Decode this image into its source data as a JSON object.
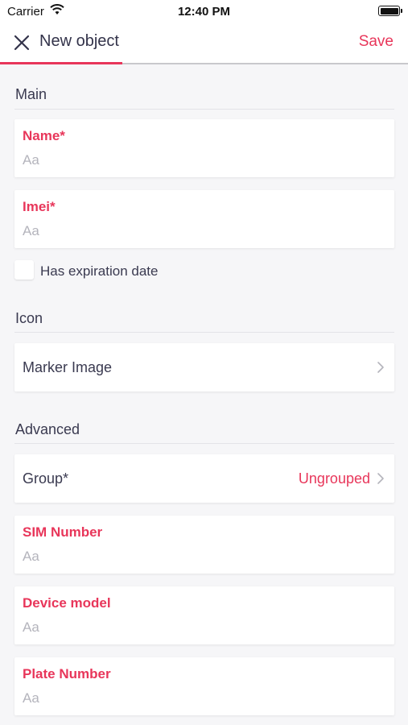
{
  "status_bar": {
    "carrier": "Carrier",
    "time": "12:40 PM"
  },
  "header": {
    "title": "New object",
    "save_label": "Save",
    "close_icon": "close-icon"
  },
  "sections": {
    "main": "Main",
    "icon": "Icon",
    "advanced": "Advanced"
  },
  "fields": {
    "name": {
      "label": "Name*",
      "placeholder": "Aa"
    },
    "imei": {
      "label": "Imei*",
      "placeholder": "Aa"
    },
    "sim_number": {
      "label": "SIM Number",
      "placeholder": "Aa"
    },
    "device_model": {
      "label": "Device model",
      "placeholder": "Aa"
    },
    "plate_number": {
      "label": "Plate Number",
      "placeholder": "Aa"
    }
  },
  "checkbox": {
    "label": "Has expiration date",
    "checked": false
  },
  "marker_image": {
    "label": "Marker Image"
  },
  "group": {
    "label": "Group*",
    "value": "Ungrouped"
  },
  "colors": {
    "accent": "#e8365a",
    "background": "#f6f6f8",
    "text": "#3a3a50",
    "placeholder": "#b4b4bc"
  }
}
